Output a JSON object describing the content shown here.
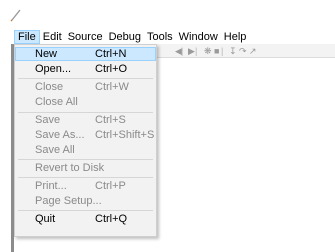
{
  "menubar": {
    "items": [
      "File",
      "Edit",
      "Source",
      "Debug",
      "Tools",
      "Window",
      "Help"
    ]
  },
  "toolbar": {
    "icons": [
      "step-back-icon",
      "play-icon",
      "bug-icon",
      "stop-icon",
      "step-into-icon",
      "step-over-icon",
      "step-out-icon"
    ]
  },
  "file_menu": {
    "new": {
      "label": "New",
      "shortcut": "Ctrl+N"
    },
    "open": {
      "label": "Open...",
      "shortcut": "Ctrl+O"
    },
    "close": {
      "label": "Close",
      "shortcut": "Ctrl+W"
    },
    "close_all": {
      "label": "Close All"
    },
    "save": {
      "label": "Save",
      "shortcut": "Ctrl+S"
    },
    "save_as": {
      "label": "Save As...",
      "shortcut": "Ctrl+Shift+S"
    },
    "save_all": {
      "label": "Save All"
    },
    "revert": {
      "label": "Revert to Disk"
    },
    "print": {
      "label": "Print...",
      "shortcut": "Ctrl+P"
    },
    "page_setup": {
      "label": "Page Setup..."
    },
    "quit": {
      "label": "Quit",
      "shortcut": "Ctrl+Q"
    }
  }
}
